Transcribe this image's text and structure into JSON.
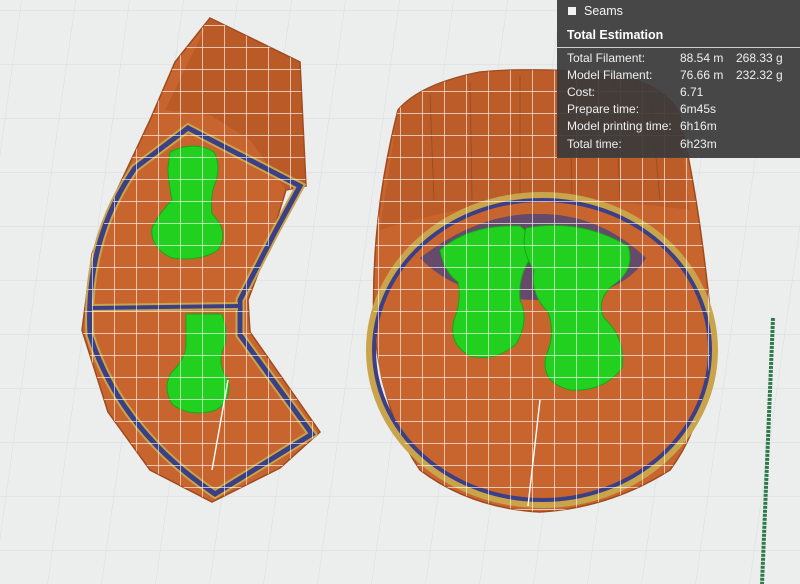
{
  "legend": {
    "seams_label": "Seams",
    "seams_color": "#f2f2f2"
  },
  "estimation": {
    "title": "Total Estimation",
    "rows": [
      {
        "label": "Total Filament:",
        "value1": "88.54 m",
        "value2": "268.33 g"
      },
      {
        "label": "Model Filament:",
        "value1": "76.66 m",
        "value2": "232.32 g"
      },
      {
        "label": "Cost:",
        "value1": "6.71",
        "value2": ""
      },
      {
        "label": "Prepare time:",
        "value1": "6m45s",
        "value2": ""
      },
      {
        "label": "Model printing time:",
        "value1": "6h16m",
        "value2": ""
      },
      {
        "label": "Total time:",
        "value1": "6h23m",
        "value2": ""
      }
    ]
  },
  "colors": {
    "background": "#eceeee",
    "wall": "#c8652e",
    "wall_dark": "#9e4a1f",
    "support": "#22d11f",
    "outer_perimeter": "#3b3f86",
    "brim": "#c9a44a",
    "grid": "#ffffff",
    "travel_bar": "#2f7a4a"
  }
}
